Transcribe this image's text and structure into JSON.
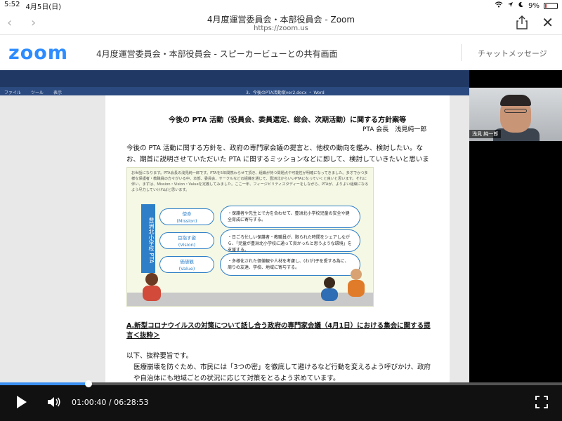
{
  "status": {
    "time": "5:52",
    "date": "4月5日(日)",
    "battery": "9%"
  },
  "nav": {
    "title": "4月度運営委員会・本部役員会 - Zoom",
    "url": "https://zoom.us"
  },
  "zoom": {
    "logo": "zoom",
    "subtitle": "4月度運営委員会・本部役員会 - スピーカービューとの共有画面",
    "chat": "チャットメッセージ"
  },
  "word": {
    "menu": [
      "ファイル",
      "ツール",
      "表示"
    ],
    "title": "3、今後のPTA活動案ver2.docx ・ Word"
  },
  "video": {
    "name_tag": "浅見 純一郎"
  },
  "doc": {
    "title": "今後の PTA 活動（役員会、委員選定、総会、次期活動）に関する方針案等",
    "author": "PTA 会長　浅見純一郎",
    "intro": "今後の PTA 活動に関する方針を、政府の専門家会議の提言と、他校の動向を鑑み、検討したい。なお、期首に説明させていただいた PTA に関するミッションなどに即して、検討していきたいと思います。",
    "figure": {
      "text": "お世話になります。PTA会長の浅見純一郎です。PTAを5年間携わらせて頂き、組織が持つ問題点や可能性が明確になってきました。多才でかつ多様な保護者・教職員の方々がいる中、本部、委員会、サークルなどの組織を通じて、豊洲北からいいPTAになっていくと良いと思います。それに伴い、まずは、Mission・Vision・Valueを定義してみました。ここ一年、フィージビリティスタディーをしながら、PTAが、よりよい組織になるよう尽力していければと思います。",
      "vertical": "豊洲北小学校 PTA",
      "rows": [
        {
          "label_jp": "使命",
          "label_en": "(Mission)",
          "desc": "・保護者や先生とで力を合わせて、豊洲北小学校児童の安全や健全育成に寄与する。"
        },
        {
          "label_jp": "目指す姿",
          "label_en": "(Vision)",
          "desc": "・日ごろ忙しい保護者・教職員が、限られた時間をシェアしながら、「児童が豊洲北小学校に通って良かったと思うような環境」を支援する。"
        },
        {
          "label_jp": "価値観",
          "label_en": "(Value)",
          "desc": "・多様化された価値観や人材を考慮し、(わが)子を愛する為に、周りの友達、学校、地域に寄与する。"
        }
      ]
    },
    "heading": "A.新型コロナウイルスの対策について話し合う政府の専門家会議（4月1日）における集会に関する提言＜抜粋＞",
    "para1": "以下、抜粋要旨です。",
    "para2": "医療崩壊を防ぐため、市民には「3つの密」を徹底して避けるなど行動を変えるよう呼びかけ、政府や自治体にも地域ごとの状況に応じて対策をとるよう求めています。"
  },
  "player": {
    "current": "01:00:40",
    "total": "06:28:53",
    "progress": 0.158
  },
  "colors": {
    "zoom_blue": "#2d8cff",
    "word_blue": "#1f3964",
    "figure_blue": "#2e7fc8"
  }
}
